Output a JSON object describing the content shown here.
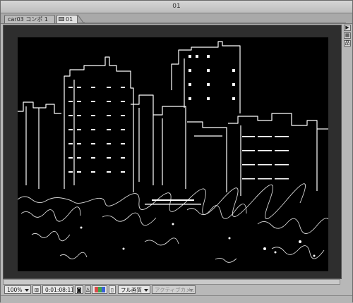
{
  "window": {
    "title": "01"
  },
  "tabs": [
    {
      "label": "car03 コンポ 1"
    },
    {
      "label": "01",
      "icon": "composition-icon"
    }
  ],
  "side_buttons": [
    {
      "icon": "panel-menu-arrow-icon",
      "glyph": "▶"
    },
    {
      "icon": "comp-flowchart-icon",
      "glyph": "▦"
    },
    {
      "icon": "grid-options-icon",
      "glyph": "品"
    }
  ],
  "toolbar": {
    "zoom": "100%",
    "timecode": "0:01:08:11",
    "quality": "フル画質",
    "camera": "アクティブカメ..."
  },
  "colors": {
    "frame": "#b8b8b8",
    "canvas": "#000000",
    "edge": "#ffffff"
  }
}
